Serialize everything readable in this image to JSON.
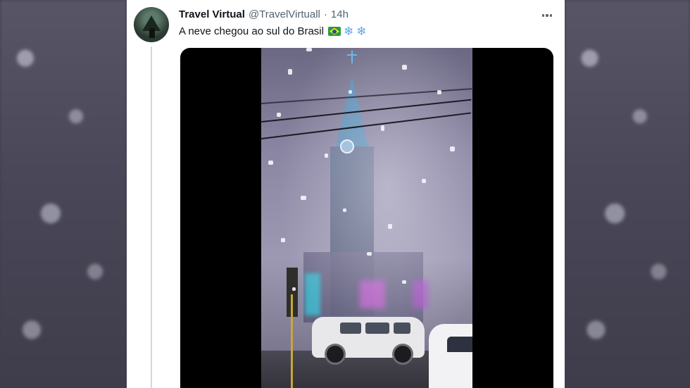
{
  "tweet": {
    "display_name": "Travel Virtual",
    "handle": "@TravelVirtuall",
    "separator": "·",
    "time": "14h",
    "text": "A neve chegou ao sul do Brasil",
    "emoji": [
      "brazil-flag",
      "snowflake",
      "snowflake"
    ],
    "snowflake_glyph": "❄"
  },
  "colors": {
    "name": "#0f1419",
    "secondary": "#536471",
    "snowflake": "#5fa8e8"
  },
  "media": {
    "type": "video"
  }
}
